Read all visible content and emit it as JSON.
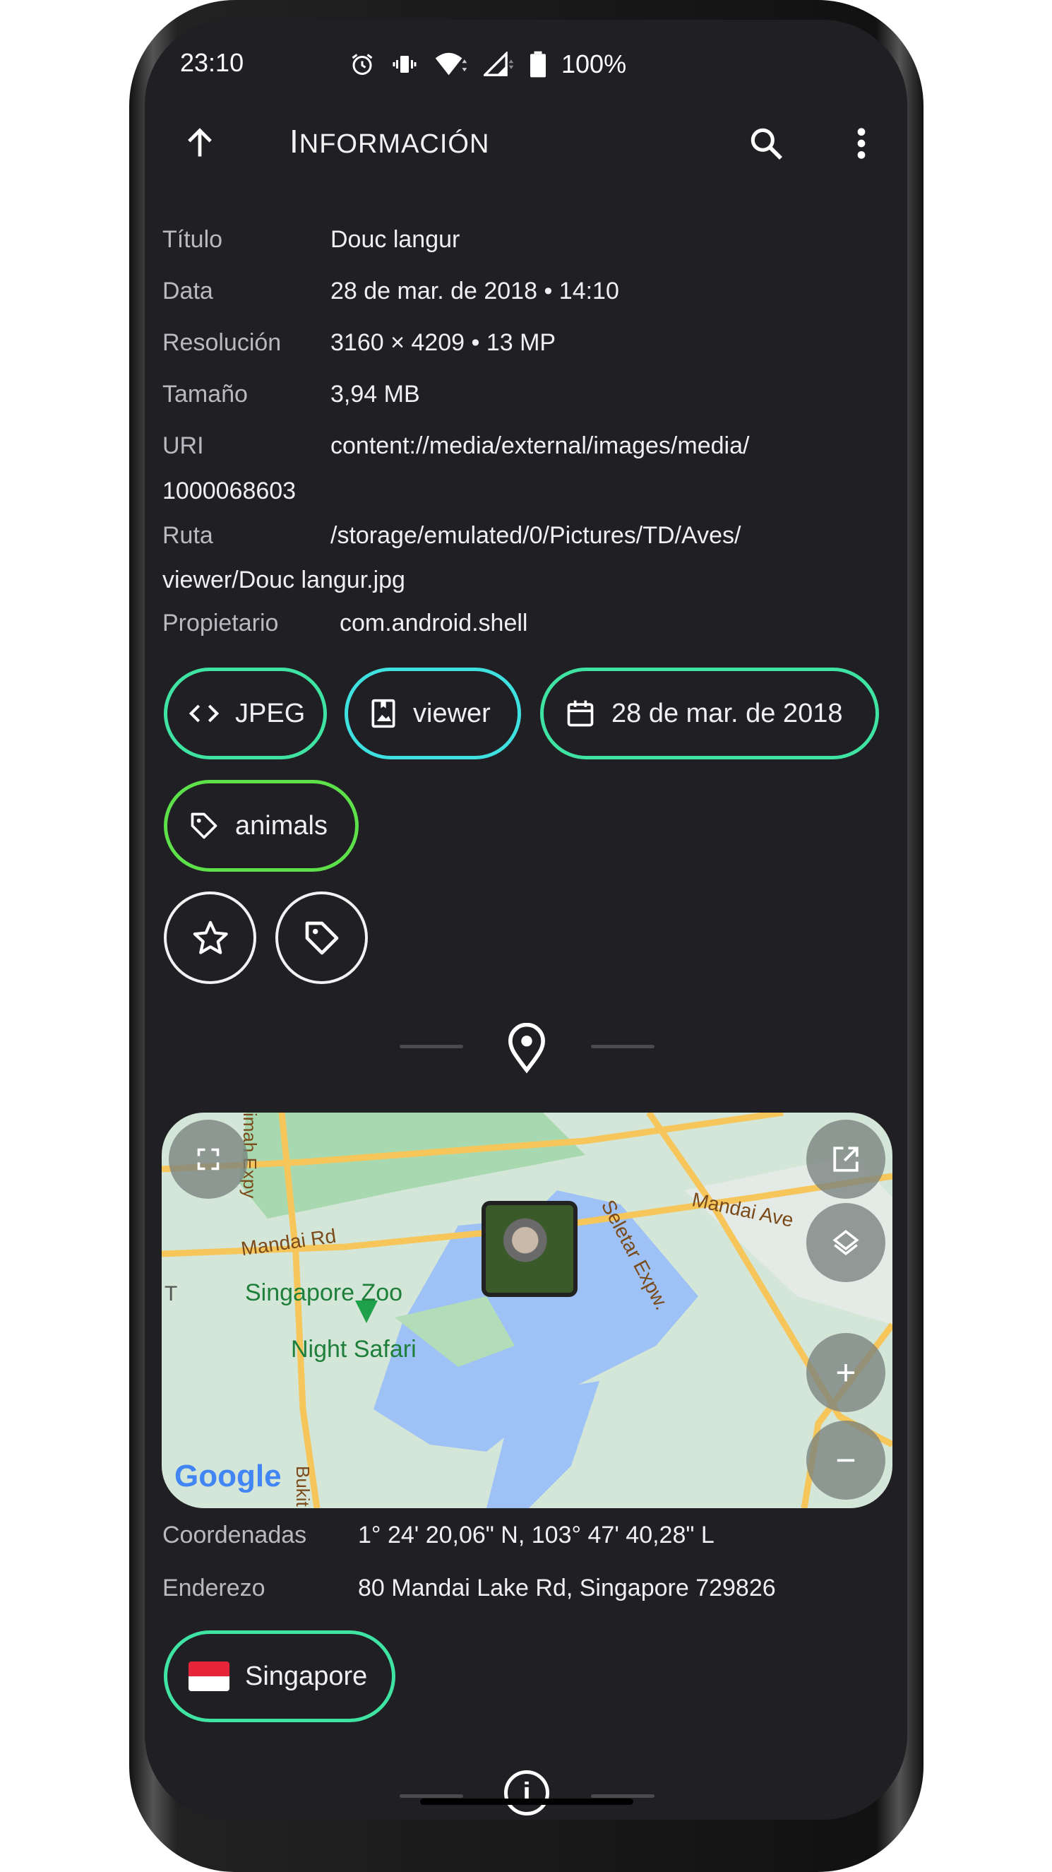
{
  "status_bar": {
    "time": "23:10",
    "battery": "100%",
    "icons": [
      "alarm-icon",
      "vibrate-icon",
      "wifi-icon",
      "signal-icon",
      "battery-icon"
    ]
  },
  "toolbar": {
    "title_first": "I",
    "title_rest": "NFORMACIÓN",
    "back_icon": "arrow-up-icon",
    "search_icon": "search-icon",
    "more_icon": "more-vert-icon"
  },
  "info": {
    "title": {
      "label": "Título",
      "value": "Douc langur"
    },
    "date": {
      "label": "Data",
      "value": "28 de mar. de 2018 • 14:10"
    },
    "resolution": {
      "label": "Resolución",
      "value": "3160 × 4209 • 13 MP"
    },
    "size": {
      "label": "Tamaño",
      "value": "3,94 MB"
    },
    "uri": {
      "label": "URI",
      "value_line1": "content://media/external/images/media/",
      "value_line2": "1000068603"
    },
    "path": {
      "label": "Ruta",
      "value_line1": "/storage/emulated/0/Pictures/TD/Aves/",
      "value_line2": "viewer/Douc langur.jpg"
    },
    "owner": {
      "label": "Propietario",
      "value": "com.android.shell"
    }
  },
  "chips": [
    {
      "label": "JPEG",
      "icon": "code-icon",
      "color": "#3fe3a2"
    },
    {
      "label": "viewer",
      "icon": "album-icon",
      "color": "#3fe0e0"
    },
    {
      "label": "28 de mar. de 2018",
      "icon": "calendar-icon",
      "color": "#3fe3a2"
    },
    {
      "label": "animals",
      "icon": "tag-icon",
      "color": "#5de04a"
    }
  ],
  "map": {
    "labels": [
      "Mandai Rd",
      "Singapore Zoo",
      "Night Safari",
      "Seletar Expw.",
      "Mandai Ave",
      "imah Expy",
      "Bukit",
      "T"
    ],
    "attribution": "Google"
  },
  "location": {
    "coords": {
      "label": "Coordenadas",
      "value": "1° 24' 20,06\" N, 103° 47' 40,28\" L"
    },
    "address": {
      "label": "Enderezo",
      "value": "80 Mandai Lake Rd, Singapore 729826"
    },
    "country_chip": {
      "label": "Singapore",
      "flag": "🇸🇬",
      "color": "#3fe3a2"
    }
  }
}
